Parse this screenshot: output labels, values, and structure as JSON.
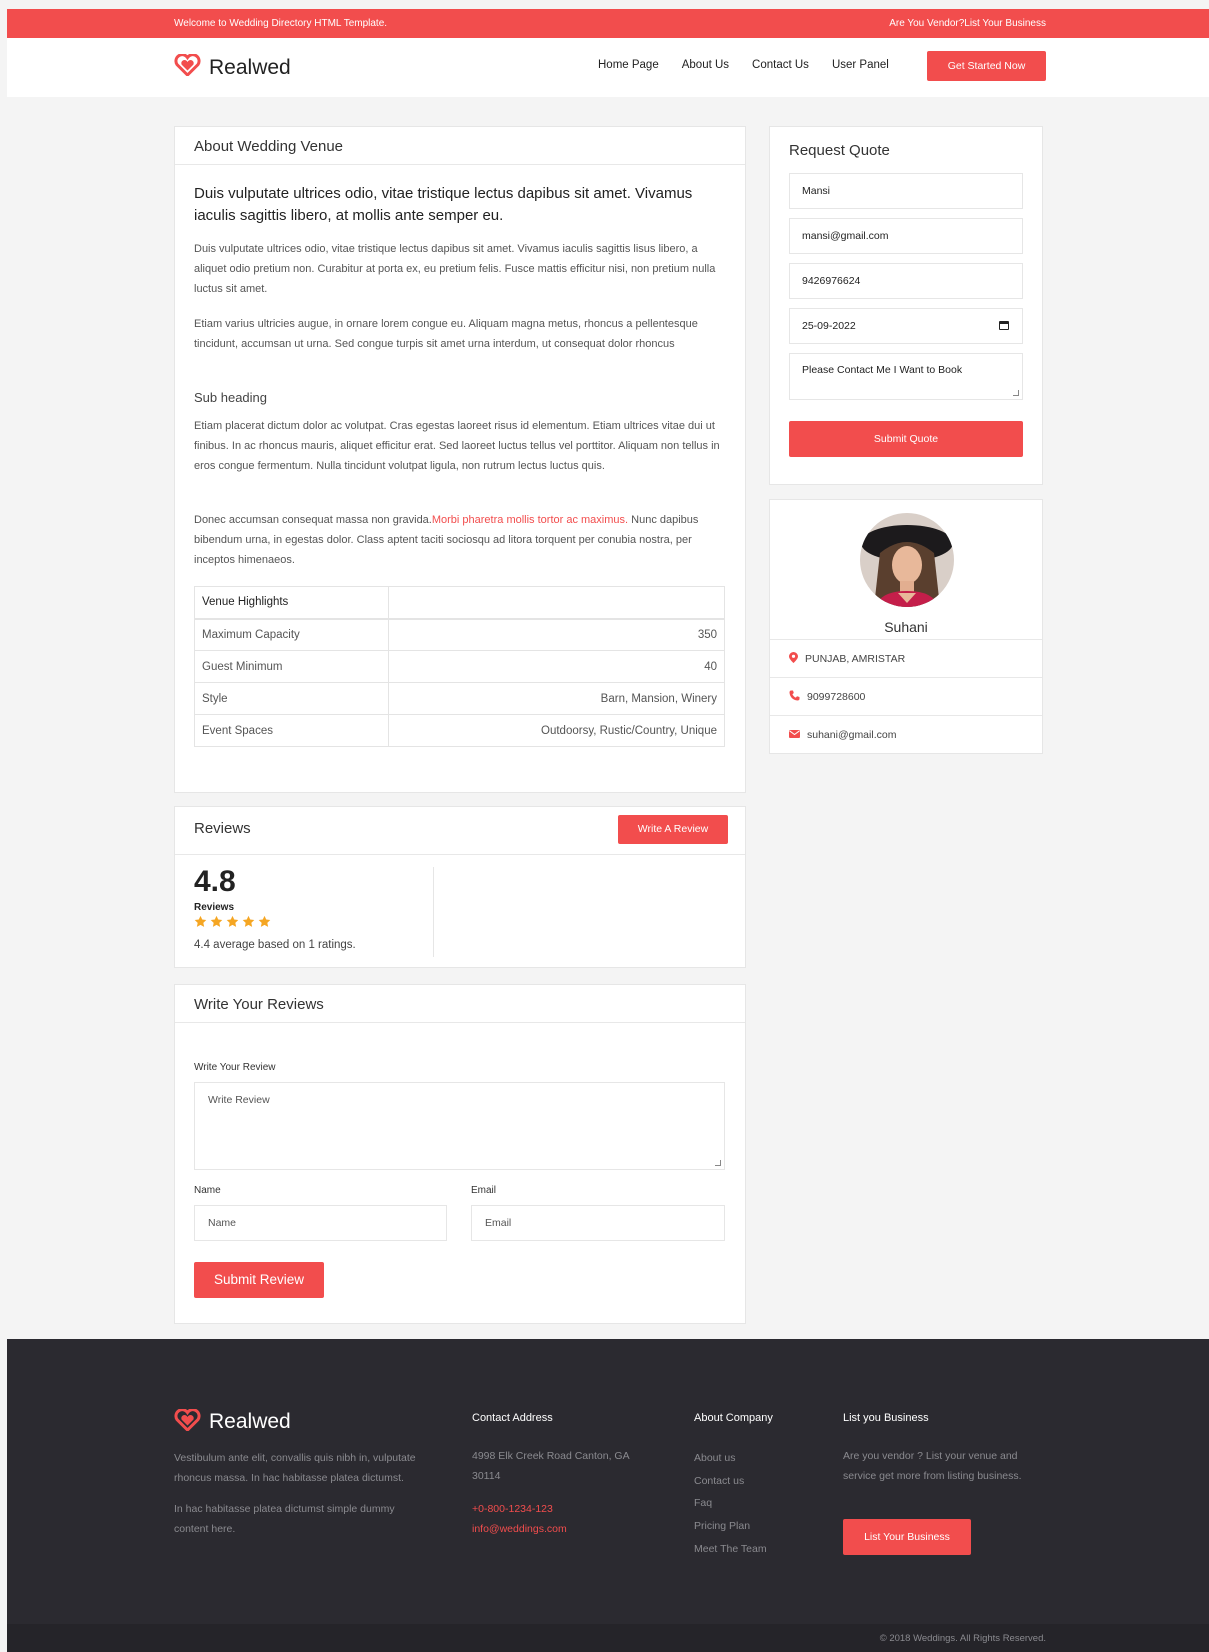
{
  "topbar": {
    "welcome": "Welcome to Wedding Directory HTML Template.",
    "vendor_link": "Are You Vendor?List Your Business"
  },
  "brand": {
    "name": "Realwed",
    "accent": "#f24d4d",
    "logo_icon": "heart-icon"
  },
  "nav": {
    "items": [
      "Home Page",
      "About Us",
      "Contact Us",
      "User Panel"
    ],
    "cta": "Get Started Now"
  },
  "about": {
    "title": "About Wedding Venue",
    "lead": "Duis vulputate ultrices odio, vitae tristique lectus dapibus sit amet. Vivamus iaculis sagittis libero, at mollis ante semper eu.",
    "p1": "Duis vulputate ultrices odio, vitae tristique lectus dapibus sit amet. Vivamus iaculis sagittis lisus libero, a aliquet odio pretium non. Curabitur at porta ex, eu pretium felis. Fusce mattis efficitur nisi, non pretium nulla luctus sit amet.",
    "p2": "Etiam varius ultricies augue, in ornare lorem congue eu. Aliquam magna metus, rhoncus a pellentesque tincidunt, accumsan ut urna. Sed congue turpis sit amet urna interdum, ut consequat dolor rhoncus",
    "subheading": "Sub heading",
    "p3": "Etiam placerat dictum dolor ac volutpat. Cras egestas laoreet risus id elementum. Etiam ultrices vitae dui ut finibus. In ac rhoncus mauris, aliquet efficitur erat. Sed laoreet luctus tellus vel porttitor. Aliquam non tellus in eros congue fermentum. Nulla tincidunt volutpat ligula, non rutrum lectus luctus quis.",
    "p4_start": "Donec accumsan consequat massa non gravida.",
    "p4_link": "Morbi pharetra mollis tortor ac maximus.",
    "p4_end": " Nunc dapibus bibendum urna, in egestas dolor. Class aptent taciti sociosqu ad litora torquent per conubia nostra, per inceptos himenaeos.",
    "highlights_header": "Venue Highlights",
    "highlights": [
      {
        "label": "Maximum Capacity",
        "value": "350"
      },
      {
        "label": "Guest Minimum",
        "value": "40"
      },
      {
        "label": "Style",
        "value": "Barn, Mansion, Winery"
      },
      {
        "label": "Event Spaces",
        "value": "Outdoorsy, Rustic/Country, Unique"
      }
    ]
  },
  "quote": {
    "title": "Request Quote",
    "name": "Mansi",
    "email": "mansi@gmail.com",
    "phone": "9426976624",
    "date": "25-09-2022",
    "message": "Please Contact Me I Want to Book",
    "submit": "Submit Quote",
    "date_icon": "calendar-icon"
  },
  "vendor": {
    "name": "Suhani",
    "location": "PUNJAB, AMRISTAR",
    "phone": "9099728600",
    "email": "suhani@gmail.com"
  },
  "reviews": {
    "title": "Reviews",
    "write_button": "Write A Review",
    "score": "4.8",
    "label": "Reviews",
    "stars": 5,
    "star_color": "#f5a623",
    "average_text": "4.4 average based on 1 ratings."
  },
  "write_review": {
    "title": "Write Your Reviews",
    "review_label": "Write Your Review",
    "review_placeholder": "Write Review",
    "name_label": "Name",
    "name_placeholder": "Name",
    "email_label": "Email",
    "email_placeholder": "Email",
    "submit": "Submit Review"
  },
  "footer": {
    "about1": "Vestibulum ante elit, convallis quis nibh in, vulputate rhoncus massa. In hac habitasse platea dictumst.",
    "about2": "In hac habitasse platea dictumst simple dummy content here.",
    "contact_title": "Contact Address",
    "address": "4998 Elk Creek Road Canton, GA 30114",
    "phone": "+0-800-1234-123",
    "email": "info@weddings.com",
    "company_title": "About Company",
    "company_links": [
      "About us",
      "Contact us",
      "Faq",
      "Pricing Plan",
      "Meet The Team"
    ],
    "list_title": "List you Business",
    "list_text": "Are you vendor ? List your venue and service get more from listing business.",
    "list_button": "List Your Business",
    "copyright": "© 2018 Weddings. All Rights Reserved."
  }
}
